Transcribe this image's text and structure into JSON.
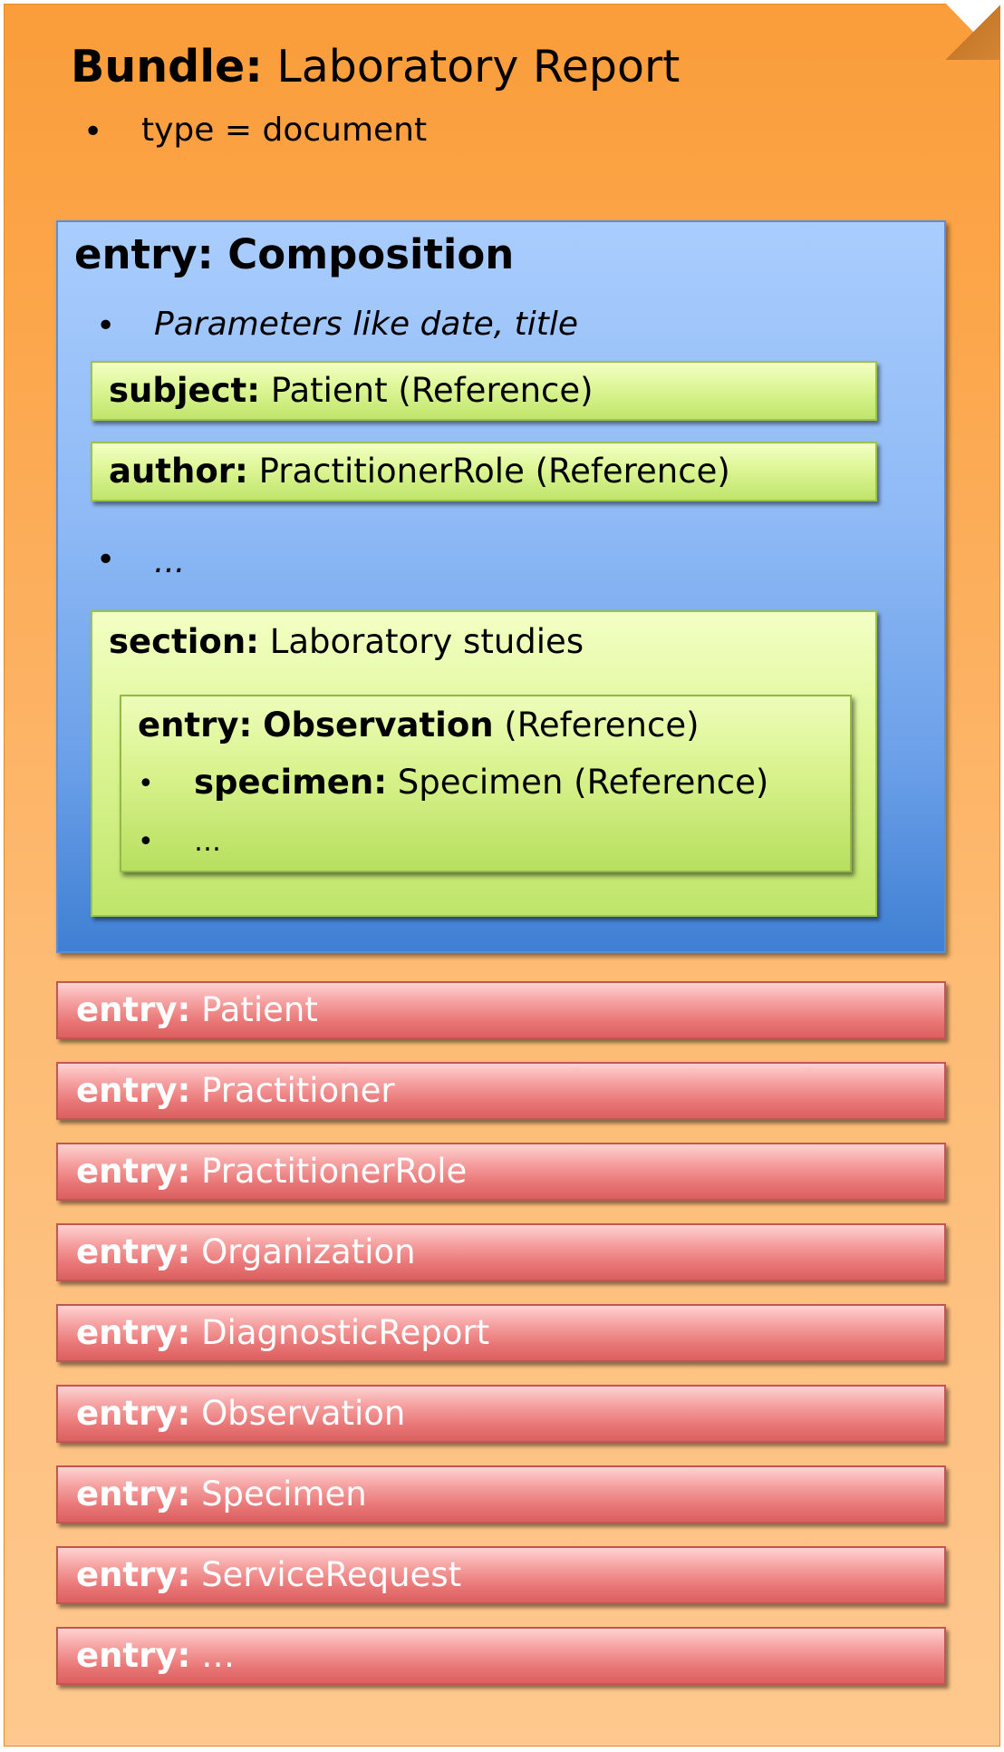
{
  "bundle": {
    "title_bold": "Bundle:",
    "title_rest": "Laboratory Report",
    "bullet_symbol": "•",
    "type_text": "type = document"
  },
  "composition": {
    "title": "entry: Composition",
    "params_text": "Parameters like date, title",
    "subject": {
      "key": "subject:",
      "value": "Patient (Reference)"
    },
    "author": {
      "key": "author:",
      "value": "PractitionerRole (Reference)"
    },
    "ellipsis": "...",
    "section": {
      "key": "section:",
      "value": "Laboratory studies",
      "entry": {
        "key": "entry:",
        "type": "Observation",
        "ref": "(Reference)",
        "specimen_key": "specimen:",
        "specimen_value": "Specimen (Reference)",
        "ellipsis": "…"
      }
    }
  },
  "entries": [
    {
      "key": "entry:",
      "value": "Patient"
    },
    {
      "key": "entry:",
      "value": "Practitioner"
    },
    {
      "key": "entry:",
      "value": "PractitionerRole"
    },
    {
      "key": "entry:",
      "value": "Organization"
    },
    {
      "key": "entry:",
      "value": "DiagnosticReport"
    },
    {
      "key": "entry:",
      "value": "Observation"
    },
    {
      "key": "entry:",
      "value": "Specimen"
    },
    {
      "key": "entry:",
      "value": "ServiceRequest"
    },
    {
      "key": "entry:",
      "value": "…"
    }
  ],
  "colors": {
    "bundle": "#fca64b",
    "composition": "#8fbaf6",
    "green": "#dff79a",
    "entry_red": "#e97777"
  }
}
